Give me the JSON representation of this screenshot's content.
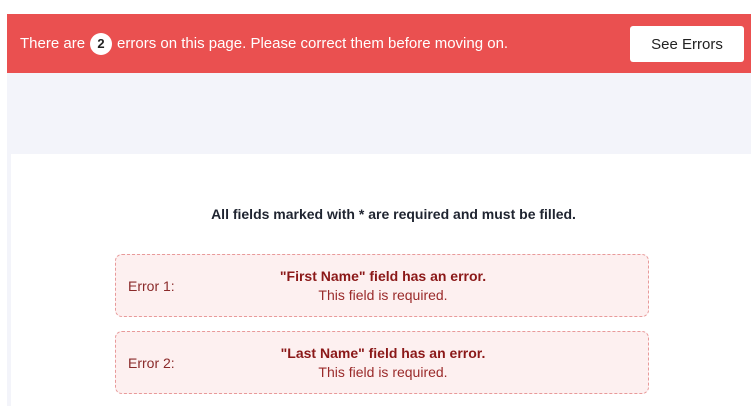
{
  "banner": {
    "text_before": "There are",
    "error_count": "2",
    "text_after": "errors on this page. Please correct them before moving on.",
    "button_label": "See Errors"
  },
  "form": {
    "required_note": "All fields marked with * are required and must be filled.",
    "errors": [
      {
        "label": "Error 1:",
        "title": "\"First Name\" field has an error.",
        "detail": "This field is required."
      },
      {
        "label": "Error 2:",
        "title": "\"Last Name\" field has an error.",
        "detail": "This field is required."
      }
    ]
  },
  "colors": {
    "banner_background": "#ea5050",
    "page_band": "#f3f4fa",
    "error_box_background": "#fdf0f0",
    "error_box_border": "#e89a9a",
    "error_title": "#8b1818"
  }
}
